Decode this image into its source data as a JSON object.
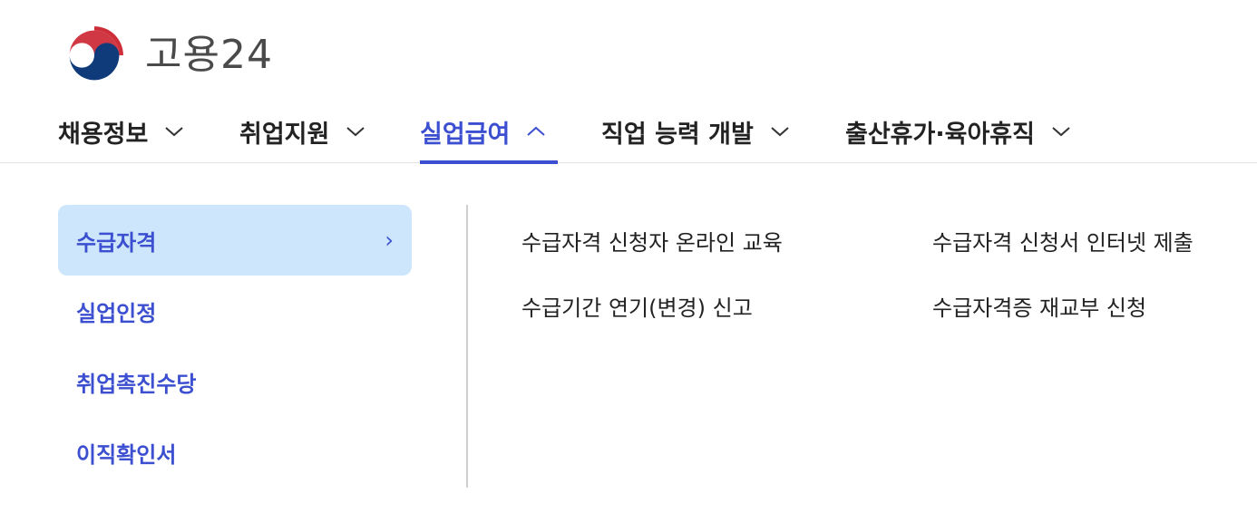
{
  "brand": {
    "name": "고용24",
    "colors": {
      "red": "#cd2e3a",
      "blue": "#0f3b7a"
    }
  },
  "nav": {
    "items": [
      {
        "label": "채용정보",
        "icon": "chevron-down-icon"
      },
      {
        "label": "취업지원",
        "icon": "chevron-down-icon"
      },
      {
        "label": "실업급여",
        "icon": "chevron-up-icon",
        "active": true
      },
      {
        "label": "직업 능력 개발",
        "icon": "chevron-down-icon"
      },
      {
        "label": "출산휴가·육아휴직",
        "icon": "chevron-down-icon"
      }
    ],
    "accent_color": "#3b4fd0"
  },
  "submenu": {
    "categories": [
      {
        "label": "수급자격",
        "active": true,
        "arrow": "›"
      },
      {
        "label": "실업인정"
      },
      {
        "label": "취업촉진수당"
      },
      {
        "label": "이직확인서"
      }
    ],
    "links": [
      "수급자격 신청자 온라인 교육",
      "수급자격 신청서 인터넷 제출",
      "수급기간 연기(변경) 신고",
      "수급자격증 재교부 신청"
    ],
    "active_bg": "#cde6fb"
  }
}
